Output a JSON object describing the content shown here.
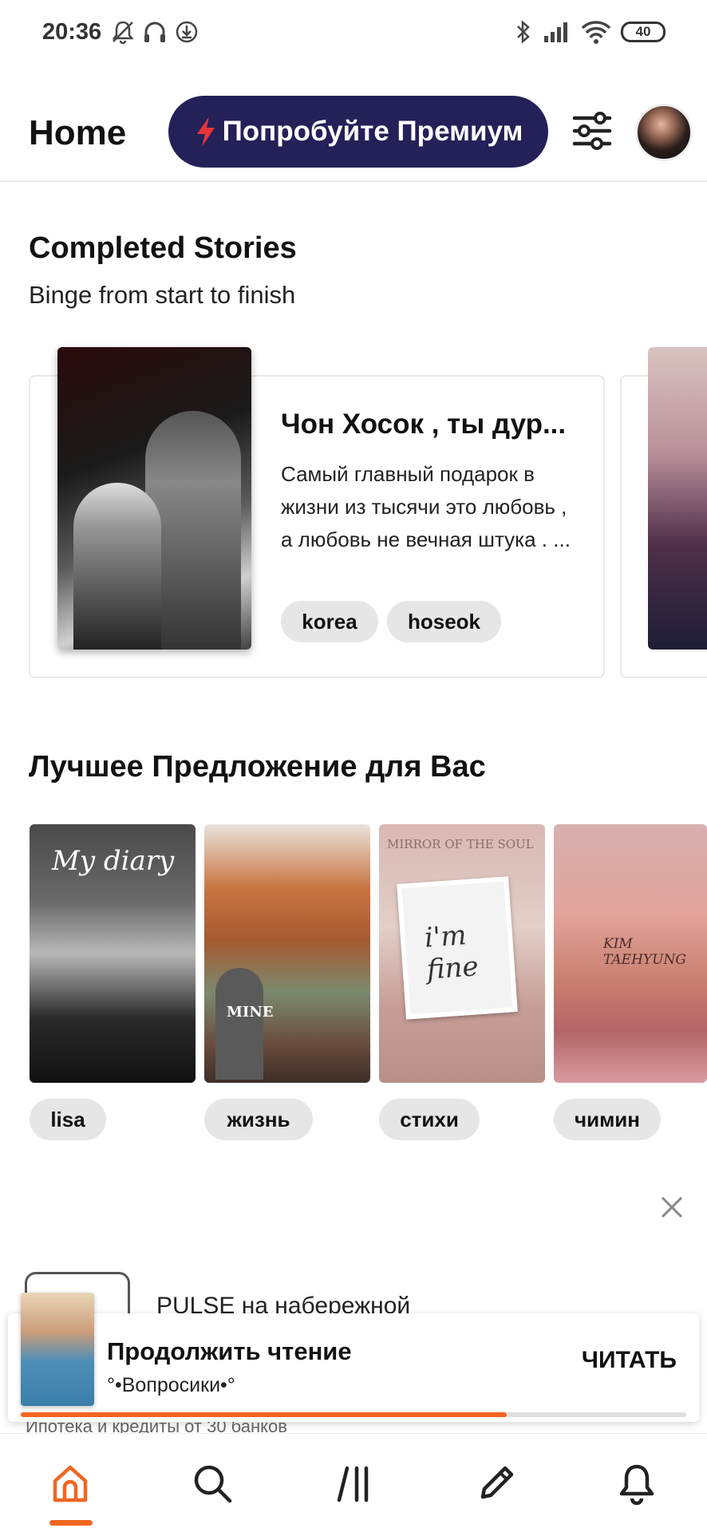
{
  "status_bar": {
    "time": "20:36",
    "battery": "40"
  },
  "header": {
    "title": "Home",
    "premium_label": "Попробуйте Премиум",
    "accent_color": "#232158"
  },
  "completed": {
    "title": "Completed Stories",
    "subtitle": "Binge from start to finish",
    "story": {
      "title": "Чон Хосок , ты дур...",
      "description": "Самый главный подарок в жизни из тысячи это любовь , а любовь не вечная штука . ...",
      "tags": [
        "korea",
        "hoseok"
      ]
    }
  },
  "best_offer": {
    "title": "Лучшее Предложение для Вас",
    "items": [
      {
        "tag": "lisa",
        "cover_text": "My diary"
      },
      {
        "tag": "жизнь",
        "cover_text": "MINE"
      },
      {
        "tag": "стихи",
        "cover_text": "MIRROR OF THE SOUL",
        "cover_text2": "i'm fine"
      },
      {
        "tag": "чимин",
        "cover_text": "KIM TAEHYUNG"
      }
    ]
  },
  "ad": {
    "title": "PULSE на набережной",
    "subtitle": "Ипотека и кредиты от 30 банков"
  },
  "continue_reading": {
    "label": "Продолжить чтение",
    "story": "°•Вопросики•°",
    "action": "ЧИТАТЬ",
    "progress": 0.73,
    "progress_color": "#f26522"
  },
  "nav": {
    "items": [
      "home-icon",
      "search-icon",
      "library-icon",
      "write-icon",
      "notifications-icon"
    ],
    "active": "home-icon"
  }
}
